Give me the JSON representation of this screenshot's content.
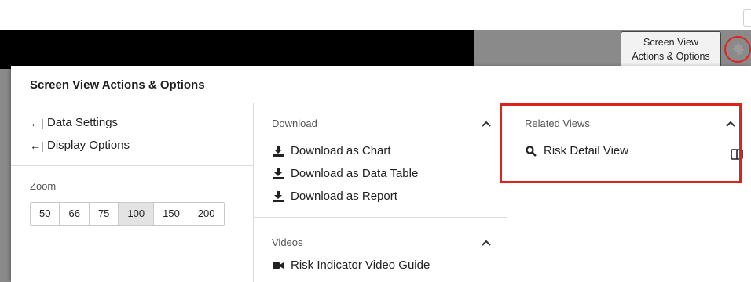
{
  "tooltip": {
    "line1": "Screen View",
    "line2": "Actions & Options"
  },
  "panel": {
    "title": "Screen View Actions & Options",
    "left": {
      "links": [
        {
          "label": "Data Settings",
          "icon": "arrow-left-bar-icon"
        },
        {
          "label": "Display Options",
          "icon": "arrow-left-bar-icon"
        }
      ],
      "zoom_label": "Zoom",
      "zoom_options": [
        "50",
        "66",
        "75",
        "100",
        "150",
        "200"
      ],
      "zoom_selected": "100"
    },
    "download": {
      "heading": "Download",
      "items": [
        {
          "label": "Download as Chart",
          "icon": "download-icon"
        },
        {
          "label": "Download as Data Table",
          "icon": "download-icon"
        },
        {
          "label": "Download as Report",
          "icon": "download-icon"
        }
      ]
    },
    "videos": {
      "heading": "Videos",
      "items": [
        {
          "label": "Risk Indicator Video Guide",
          "icon": "video-camera-icon"
        }
      ]
    },
    "related": {
      "heading": "Related Views",
      "items": [
        {
          "label": "Risk Detail View",
          "icon": "search-icon"
        }
      ]
    }
  },
  "colors": {
    "highlight": "#e0221d",
    "header_bar": "#000000",
    "side_bar": "#8a8a8a"
  }
}
